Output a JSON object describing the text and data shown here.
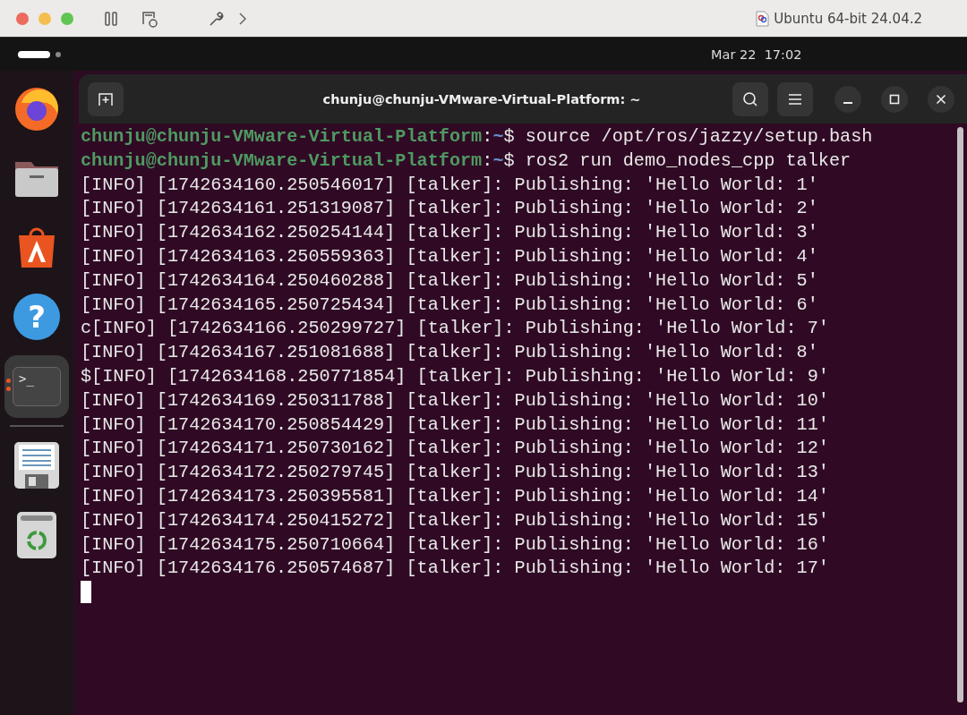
{
  "host_toolbar": {
    "vm_name": "Ubuntu 64-bit 24.04.2"
  },
  "top_bar": {
    "clock": "Mar 22  17:02"
  },
  "dock": [
    {
      "kind": "firefox",
      "selected": false,
      "running": false
    },
    {
      "kind": "files",
      "selected": false,
      "running": false
    },
    {
      "kind": "app-center",
      "selected": false,
      "running": false
    },
    {
      "kind": "help",
      "selected": false,
      "running": false,
      "glyph": "?"
    },
    {
      "kind": "terminal",
      "selected": true,
      "running": true,
      "glyph": ">_"
    },
    {
      "kind": "text-editor",
      "selected": false,
      "running": false
    },
    {
      "kind": "trash",
      "selected": false,
      "running": false
    }
  ],
  "terminal": {
    "title": "chunju@chunju-VMware-Virtual-Platform: ~",
    "lines": [
      {
        "kind": "prompt",
        "user": "chunju@chunju-VMware-Virtual-Platform",
        "sep": ":",
        "path": "~",
        "command": "$ source /opt/ros/jazzy/setup.bash"
      },
      {
        "kind": "prompt",
        "user": "chunju@chunju-VMware-Virtual-Platform",
        "sep": ":",
        "path": "~",
        "command": "$ ros2 run demo_nodes_cpp talker"
      },
      {
        "kind": "log",
        "text": "[INFO] [1742634160.250546017] [talker]: Publishing: 'Hello World: 1'"
      },
      {
        "kind": "log",
        "text": "[INFO] [1742634161.251319087] [talker]: Publishing: 'Hello World: 2'"
      },
      {
        "kind": "log",
        "text": "[INFO] [1742634162.250254144] [talker]: Publishing: 'Hello World: 3'"
      },
      {
        "kind": "log",
        "text": "[INFO] [1742634163.250559363] [talker]: Publishing: 'Hello World: 4'"
      },
      {
        "kind": "log",
        "text": "[INFO] [1742634164.250460288] [talker]: Publishing: 'Hello World: 5'"
      },
      {
        "kind": "log",
        "text": "[INFO] [1742634165.250725434] [talker]: Publishing: 'Hello World: 6'"
      },
      {
        "kind": "log",
        "text": "c[INFO] [1742634166.250299727] [talker]: Publishing: 'Hello World: 7'"
      },
      {
        "kind": "log",
        "text": "[INFO] [1742634167.251081688] [talker]: Publishing: 'Hello World: 8'"
      },
      {
        "kind": "log",
        "text": "$[INFO] [1742634168.250771854] [talker]: Publishing: 'Hello World: 9'"
      },
      {
        "kind": "log",
        "text": "[INFO] [1742634169.250311788] [talker]: Publishing: 'Hello World: 10'"
      },
      {
        "kind": "log",
        "text": "[INFO] [1742634170.250854429] [talker]: Publishing: 'Hello World: 11'"
      },
      {
        "kind": "log",
        "text": "[INFO] [1742634171.250730162] [talker]: Publishing: 'Hello World: 12'"
      },
      {
        "kind": "log",
        "text": "[INFO] [1742634172.250279745] [talker]: Publishing: 'Hello World: 13'"
      },
      {
        "kind": "log",
        "text": "[INFO] [1742634173.250395581] [talker]: Publishing: 'Hello World: 14'"
      },
      {
        "kind": "log",
        "text": "[INFO] [1742634174.250415272] [talker]: Publishing: 'Hello World: 15'"
      },
      {
        "kind": "log",
        "text": "[INFO] [1742634175.250710664] [talker]: Publishing: 'Hello World: 16'"
      },
      {
        "kind": "log",
        "text": "[INFO] [1742634176.250574687] [talker]: Publishing: 'Hello World: 17'"
      },
      {
        "kind": "cursor"
      }
    ]
  }
}
